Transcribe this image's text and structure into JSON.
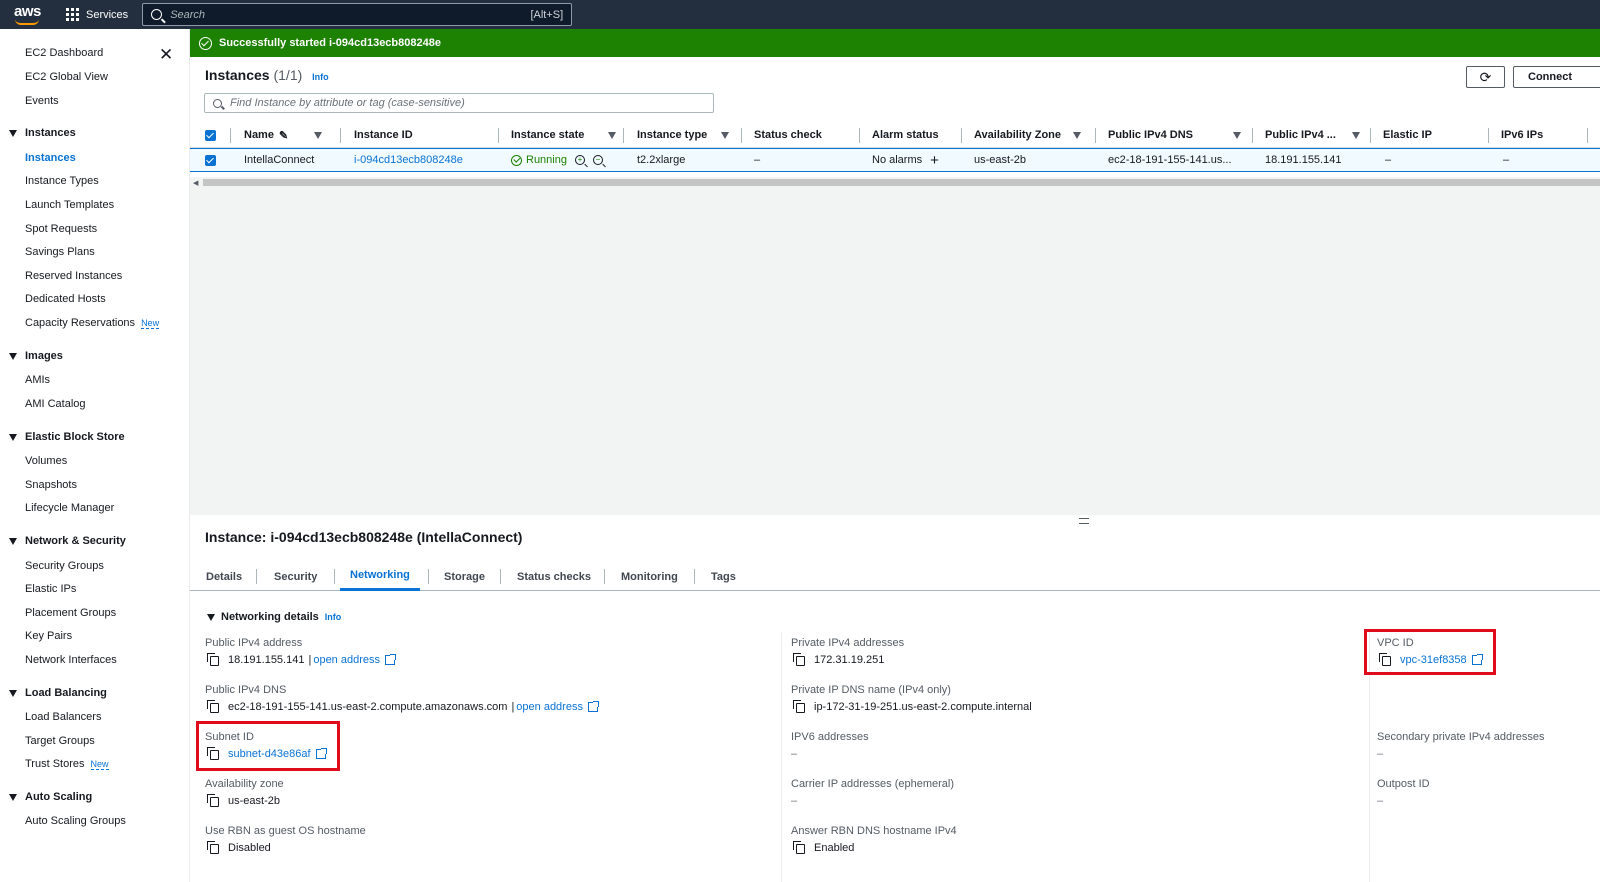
{
  "topbar": {
    "logo": "aws",
    "services_label": "Services",
    "search_placeholder": "Search",
    "search_shortcut": "[Alt+S]"
  },
  "sidebar": {
    "top_items": [
      "EC2 Dashboard",
      "EC2 Global View",
      "Events"
    ],
    "sections": [
      {
        "title": "Instances",
        "items": [
          "Instances",
          "Instance Types",
          "Launch Templates",
          "Spot Requests",
          "Savings Plans",
          "Reserved Instances",
          "Dedicated Hosts",
          "Capacity Reservations"
        ]
      },
      {
        "title": "Images",
        "items": [
          "AMIs",
          "AMI Catalog"
        ]
      },
      {
        "title": "Elastic Block Store",
        "items": [
          "Volumes",
          "Snapshots",
          "Lifecycle Manager"
        ]
      },
      {
        "title": "Network & Security",
        "items": [
          "Security Groups",
          "Elastic IPs",
          "Placement Groups",
          "Key Pairs",
          "Network Interfaces"
        ]
      },
      {
        "title": "Load Balancing",
        "items": [
          "Load Balancers",
          "Target Groups",
          "Trust Stores"
        ]
      },
      {
        "title": "Auto Scaling",
        "items": [
          "Auto Scaling Groups"
        ]
      }
    ],
    "new_badge": "New"
  },
  "banner": {
    "text": "Successfully started i-094cd13ecb808248e"
  },
  "instances": {
    "title": "Instances",
    "count": "(1/1)",
    "info": "Info",
    "connect_label": "Connect",
    "filter_placeholder": "Find Instance by attribute or tag (case-sensitive)",
    "columns": [
      "Name",
      "Instance ID",
      "Instance state",
      "Instance type",
      "Status check",
      "Alarm status",
      "Availability Zone",
      "Public IPv4 DNS",
      "Public IPv4 ...",
      "Elastic IP",
      "IPv6 IPs"
    ],
    "row": {
      "name": "IntellaConnect",
      "instance_id": "i-094cd13ecb808248e",
      "state": "Running",
      "type": "t2.2xlarge",
      "status_check": "–",
      "alarm": "No alarms",
      "az": "us-east-2b",
      "dns": "ec2-18-191-155-141.us...",
      "ipv4": "18.191.155.141",
      "elastic_ip": "–",
      "ipv6": "–"
    }
  },
  "details": {
    "title": "Instance: i-094cd13ecb808248e (IntellaConnect)",
    "tabs": [
      "Details",
      "Security",
      "Networking",
      "Storage",
      "Status checks",
      "Monitoring",
      "Tags"
    ],
    "section_title": "Networking details",
    "info": "Info",
    "open_address": "open address",
    "fields": {
      "public_ipv4_label": "Public IPv4 address",
      "public_ipv4_value": "18.191.155.141",
      "public_dns_label": "Public IPv4 DNS",
      "public_dns_value": "ec2-18-191-155-141.us-east-2.compute.amazonaws.com",
      "subnet_label": "Subnet ID",
      "subnet_value": "subnet-d43e86af",
      "az_label": "Availability zone",
      "az_value": "us-east-2b",
      "rbn_label": "Use RBN as guest OS hostname",
      "rbn_value": "Disabled",
      "private_ipv4_label": "Private IPv4 addresses",
      "private_ipv4_value": "172.31.19.251",
      "private_dns_label": "Private IP DNS name (IPv4 only)",
      "private_dns_value": "ip-172-31-19-251.us-east-2.compute.internal",
      "ipv6_label": "IPV6 addresses",
      "ipv6_value": "–",
      "carrier_label": "Carrier IP addresses (ephemeral)",
      "carrier_value": "–",
      "answer_rbn_label": "Answer RBN DNS hostname IPv4",
      "answer_rbn_value": "Enabled",
      "vpc_label": "VPC ID",
      "vpc_value": "vpc-31ef8358",
      "secondary_label": "Secondary private IPv4 addresses",
      "secondary_value": "–",
      "outpost_label": "Outpost ID",
      "outpost_value": "–"
    }
  },
  "colors": {
    "topbar": "#232f3e",
    "success": "#1d8102",
    "link": "#0972d3",
    "highlight": "#e00b1c"
  }
}
